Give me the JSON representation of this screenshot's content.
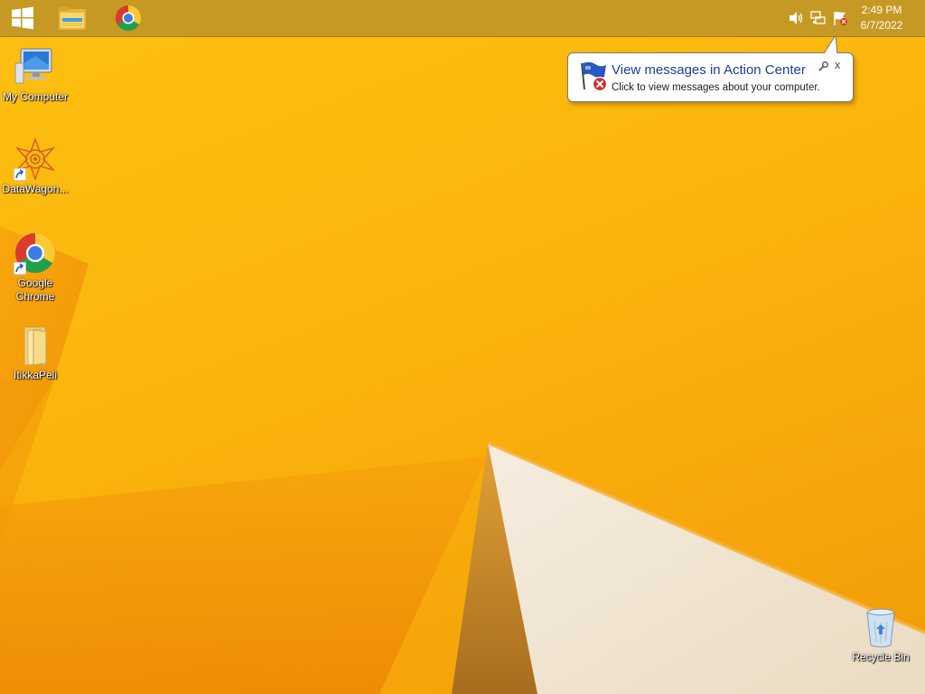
{
  "taskbar": {
    "start_icon": "windows-logo-icon",
    "pinned": [
      {
        "name": "File Explorer",
        "icon": "file-explorer-icon"
      },
      {
        "name": "Google Chrome",
        "icon": "chrome-icon"
      }
    ],
    "tray": {
      "icons": [
        "volume-icon",
        "network-icon",
        "action-center-flag-icon"
      ],
      "time": "2:49 PM",
      "date": "6/7/2022"
    }
  },
  "balloon": {
    "title": "View messages in Action Center",
    "text": "Click to view messages about your computer.",
    "close_label": "x",
    "icon": "action-center-flag-error-icon"
  },
  "desktop": {
    "icons": [
      {
        "label": "My Computer",
        "icon": "computer-icon"
      },
      {
        "label": "DataWagon...",
        "icon": "datawagon-icon"
      },
      {
        "label": "Google Chrome",
        "icon": "chrome-icon"
      },
      {
        "label": "ItikkaPeli",
        "icon": "folder-icon"
      },
      {
        "label": "Recycle Bin",
        "icon": "recycle-bin-icon"
      }
    ]
  },
  "colors": {
    "wallpaper_primary": "#fbb60d",
    "wallpaper_shadow": "#e88a06",
    "taskbar": "#c19626",
    "balloon_title": "#1a3e9e"
  }
}
